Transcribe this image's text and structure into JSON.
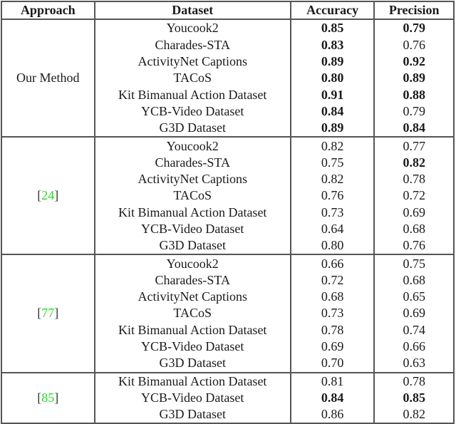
{
  "header": {
    "approach": "Approach",
    "dataset": "Dataset",
    "accuracy": "Accuracy",
    "precision": "Precision"
  },
  "colors": {
    "reference_link": "#22dd22",
    "border": "#555555"
  },
  "groups": [
    {
      "approach": "Our Method",
      "is_ref": false,
      "rows": [
        {
          "dataset": "Youcook2",
          "accuracy": "0.85",
          "acc_bold": true,
          "precision": "0.79",
          "prec_bold": true
        },
        {
          "dataset": "Charades-STA",
          "accuracy": "0.83",
          "acc_bold": true,
          "precision": "0.76",
          "prec_bold": false
        },
        {
          "dataset": "ActivityNet Captions",
          "accuracy": "0.89",
          "acc_bold": true,
          "precision": "0.92",
          "prec_bold": true
        },
        {
          "dataset": "TACoS",
          "accuracy": "0.80",
          "acc_bold": true,
          "precision": "0.89",
          "prec_bold": true
        },
        {
          "dataset": "Kit Bimanual Action Dataset",
          "accuracy": "0.91",
          "acc_bold": true,
          "precision": "0.88",
          "prec_bold": true
        },
        {
          "dataset": "YCB-Video Dataset",
          "accuracy": "0.84",
          "acc_bold": true,
          "precision": "0.79",
          "prec_bold": false
        },
        {
          "dataset": "G3D Dataset",
          "accuracy": "0.89",
          "acc_bold": true,
          "precision": "0.84",
          "prec_bold": true
        }
      ]
    },
    {
      "approach": "24",
      "is_ref": true,
      "rows": [
        {
          "dataset": "Youcook2",
          "accuracy": "0.82",
          "acc_bold": false,
          "precision": "0.77",
          "prec_bold": false
        },
        {
          "dataset": "Charades-STA",
          "accuracy": "0.75",
          "acc_bold": false,
          "precision": "0.82",
          "prec_bold": true
        },
        {
          "dataset": "ActivityNet Captions",
          "accuracy": "0.82",
          "acc_bold": false,
          "precision": "0.78",
          "prec_bold": false
        },
        {
          "dataset": "TACoS",
          "accuracy": "0.76",
          "acc_bold": false,
          "precision": "0.72",
          "prec_bold": false
        },
        {
          "dataset": "Kit Bimanual Action Dataset",
          "accuracy": "0.73",
          "acc_bold": false,
          "precision": "0.69",
          "prec_bold": false
        },
        {
          "dataset": "YCB-Video Dataset",
          "accuracy": "0.64",
          "acc_bold": false,
          "precision": "0.68",
          "prec_bold": false
        },
        {
          "dataset": "G3D Dataset",
          "accuracy": "0.80",
          "acc_bold": false,
          "precision": "0.76",
          "prec_bold": false
        }
      ]
    },
    {
      "approach": "77",
      "is_ref": true,
      "rows": [
        {
          "dataset": "Youcook2",
          "accuracy": "0.66",
          "acc_bold": false,
          "precision": "0.75",
          "prec_bold": false
        },
        {
          "dataset": "Charades-STA",
          "accuracy": "0.72",
          "acc_bold": false,
          "precision": "0.68",
          "prec_bold": false
        },
        {
          "dataset": "ActivityNet Captions",
          "accuracy": "0.68",
          "acc_bold": false,
          "precision": "0.65",
          "prec_bold": false
        },
        {
          "dataset": "TACoS",
          "accuracy": "0.73",
          "acc_bold": false,
          "precision": "0.69",
          "prec_bold": false
        },
        {
          "dataset": "Kit Bimanual Action Dataset",
          "accuracy": "0.78",
          "acc_bold": false,
          "precision": "0.74",
          "prec_bold": false
        },
        {
          "dataset": "YCB-Video Dataset",
          "accuracy": "0.69",
          "acc_bold": false,
          "precision": "0.66",
          "prec_bold": false
        },
        {
          "dataset": "G3D Dataset",
          "accuracy": "0.70",
          "acc_bold": false,
          "precision": "0.63",
          "prec_bold": false
        }
      ]
    },
    {
      "approach": "85",
      "is_ref": true,
      "rows": [
        {
          "dataset": "Kit Bimanual Action Dataset",
          "accuracy": "0.81",
          "acc_bold": false,
          "precision": "0.78",
          "prec_bold": false
        },
        {
          "dataset": "YCB-Video Dataset",
          "accuracy": "0.84",
          "acc_bold": true,
          "precision": "0.85",
          "prec_bold": true
        },
        {
          "dataset": "G3D Dataset",
          "accuracy": "0.86",
          "acc_bold": false,
          "precision": "0.82",
          "prec_bold": false
        }
      ]
    }
  ]
}
